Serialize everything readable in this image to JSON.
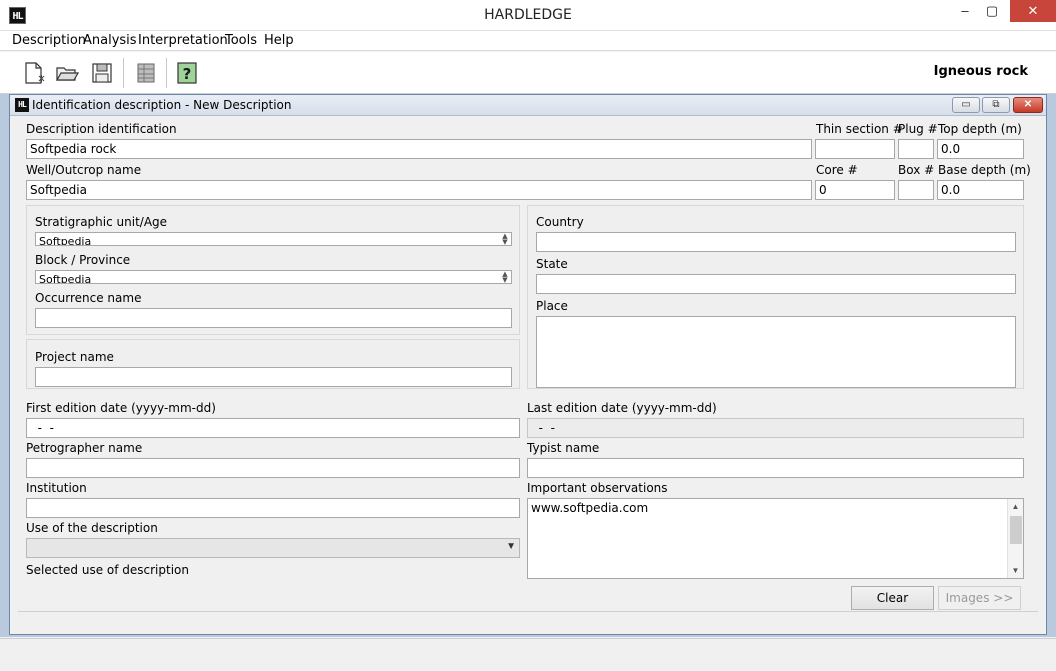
{
  "window": {
    "title": "HARDLEDGE",
    "icon_text": "HL",
    "minimize_glyph": "‒",
    "maximize_glyph": "▢",
    "close_glyph": "✕"
  },
  "menu": [
    "Description",
    "Analysis",
    "Interpretation",
    "Tools",
    "Help"
  ],
  "toolbar": {
    "icons": [
      "new-document-icon",
      "open-folder-icon",
      "save-disk-icon",
      "table-icon",
      "help-icon"
    ],
    "rock_type": "Igneous rock"
  },
  "inner_window": {
    "title": "Identification description - New Description",
    "icon_text": "HL",
    "minimize_glyph": "▭",
    "restore_glyph": "⧉",
    "close_glyph": "✕"
  },
  "form": {
    "description_identification": {
      "label": "Description identification",
      "value": "Softpedia rock"
    },
    "thin_section": {
      "label": "Thin section #",
      "value": ""
    },
    "plug": {
      "label": "Plug #",
      "value": ""
    },
    "top_depth": {
      "label": "Top depth (m)",
      "value": "0.0"
    },
    "well_outcrop": {
      "label": "Well/Outcrop name",
      "value": "Softpedia"
    },
    "core": {
      "label": "Core #",
      "value": "0"
    },
    "box": {
      "label": "Box #",
      "value": ""
    },
    "base_depth": {
      "label": "Base depth (m)",
      "value": "0.0"
    },
    "stratigraphic_unit": {
      "label": "Stratigraphic unit/Age",
      "value": "Softpedia"
    },
    "block_province": {
      "label": "Block / Province",
      "value": "Softpedia"
    },
    "occurrence_name": {
      "label": "Occurrence name",
      "value": ""
    },
    "project_name": {
      "label": "Project name",
      "value": ""
    },
    "country": {
      "label": "Country",
      "value": ""
    },
    "state": {
      "label": "State",
      "value": ""
    },
    "place": {
      "label": "Place",
      "value": ""
    },
    "first_edition_date": {
      "label": "First edition date (yyyy-mm-dd)",
      "value": "  -  -"
    },
    "last_edition_date": {
      "label": "Last edition date (yyyy-mm-dd)",
      "value": "  -  -"
    },
    "petrographer_name": {
      "label": "Petrographer name",
      "value": ""
    },
    "typist_name": {
      "label": "Typist name",
      "value": ""
    },
    "institution": {
      "label": "Institution",
      "value": ""
    },
    "important_observations": {
      "label": "Important observations",
      "value": "www.softpedia.com"
    },
    "use_of_description": {
      "label": "Use of the description",
      "value": ""
    },
    "selected_use": {
      "label": "Selected use of description"
    }
  },
  "buttons": {
    "clear": "Clear",
    "images": "Images >>"
  }
}
